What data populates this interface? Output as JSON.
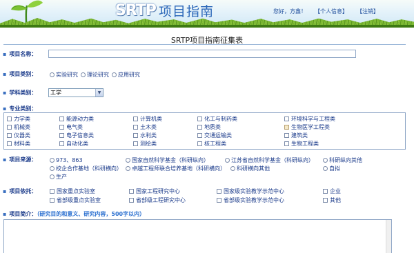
{
  "header": {
    "logo_main": "SRTP",
    "logo_sub": "项目指南",
    "welcome": "您好，方鑫！",
    "personal_info_link": "【个人信息】",
    "logout_link": "【注销】"
  },
  "form": {
    "title": "SRTP项目指南征集表",
    "project_name": {
      "label": "项目名称：",
      "value": ""
    },
    "project_type": {
      "label": "项目类别：",
      "options": [
        "实验研究",
        "理论研究",
        "应用研究"
      ]
    },
    "subject_category": {
      "label": "学科类别：",
      "selected": "工学"
    },
    "major_category": {
      "label": "专业类别：",
      "columns": [
        [
          "力学类",
          "机械类",
          "仪器类",
          "材料类"
        ],
        [
          "能源动力类",
          "电气类",
          "电子信息类",
          "自动化类"
        ],
        [
          "计算机类",
          "土木类",
          "水利类",
          "测绘类"
        ],
        [
          "化工与制药类",
          "地质类",
          "交通运输类",
          "核工程类"
        ],
        [
          "环境科学与工程类",
          "生物医学工程类",
          "建筑类",
          "生物工程类"
        ]
      ]
    },
    "project_source": {
      "label": "项目来源：",
      "options_row1": [
        "973、863",
        "国家自然科学基金（科研纵向）",
        "江苏省自然科学基金（科研纵向）",
        "科研纵向其他"
      ],
      "options_row2": [
        "校企合作基地（科研横向）",
        "卓越工程师联合培养基地（科研横向）",
        "科研横向其他",
        "自拟"
      ],
      "options_row3": [
        "生产"
      ]
    },
    "project_support": {
      "label": "项目依托：",
      "row1": [
        "国家重点实验室",
        "国家工程研究中心",
        "国家级实验教学示范中心",
        "企业"
      ],
      "row2": [
        "省部级重点实验室",
        "省部级工程研究中心",
        "省部级实验教学示范中心",
        "其他"
      ]
    },
    "project_intro": {
      "label": "项目简介：",
      "hint": "（研究目的和意义、研究内容，500字以内）"
    }
  }
}
